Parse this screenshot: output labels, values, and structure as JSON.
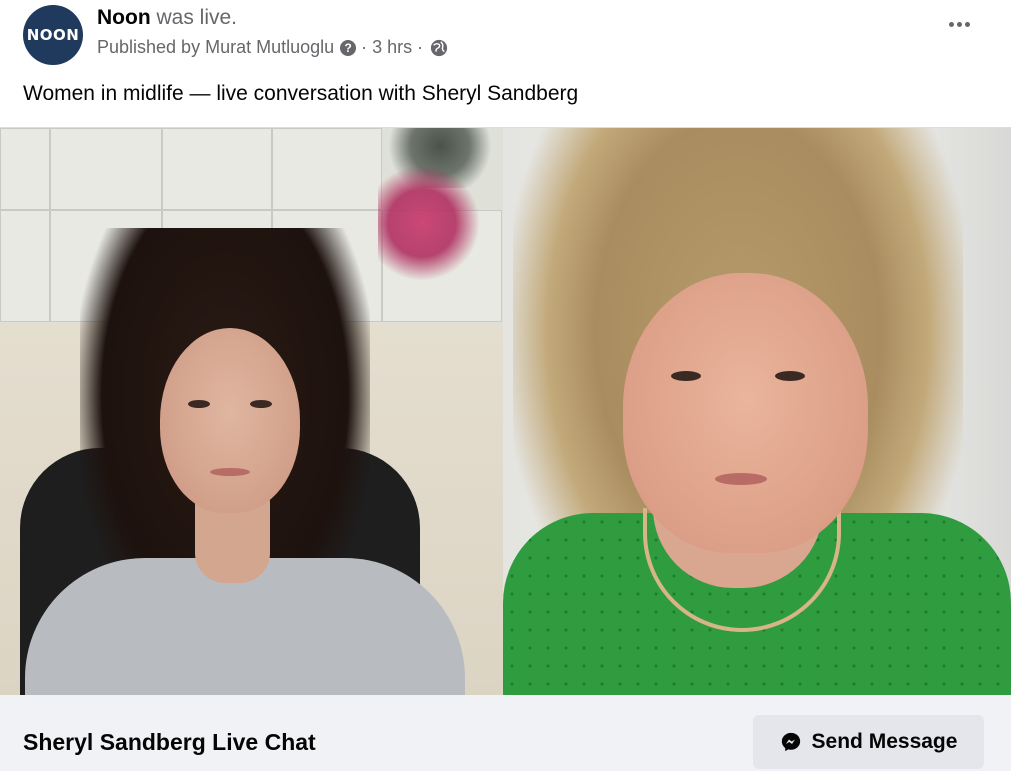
{
  "header": {
    "avatar_text": "NOON",
    "page_name": "Noon",
    "status": " was live.",
    "published_by": "Published by Murat Mutluoglu",
    "info_glyph": "?",
    "time": "3 hrs",
    "separator": "·",
    "privacy_icon": "globe-icon",
    "more_icon": "more-options-icon"
  },
  "post": {
    "caption": "Women in midlife — live conversation with Sheryl Sandberg"
  },
  "footer": {
    "title": "Sheryl Sandberg Live Chat",
    "button_label": "Send Message",
    "button_icon": "messenger-icon"
  },
  "colors": {
    "avatar_bg": "#1f3a5c",
    "secondary_text": "#65676b",
    "footer_bg": "#f0f2f5",
    "button_bg": "#e4e6eb"
  }
}
